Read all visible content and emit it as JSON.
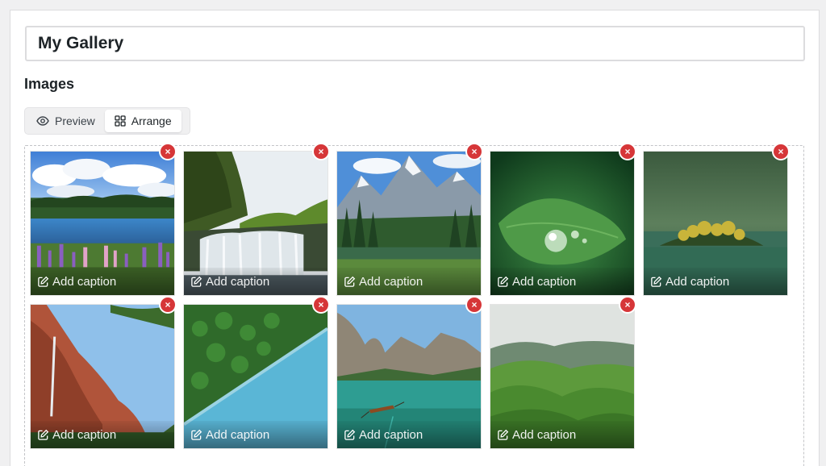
{
  "gallery": {
    "title_value": "My Gallery",
    "section_heading": "Images",
    "view_toggle": [
      {
        "label": "Preview",
        "icon": "eye-icon",
        "active": false
      },
      {
        "label": "Arrange",
        "icon": "grid-icon",
        "active": true
      }
    ],
    "accent_color": "#d63638",
    "images": [
      {
        "subject": "lake-with-lupines",
        "caption_placeholder": "Add caption",
        "remove_label": "×"
      },
      {
        "subject": "waterfall-cliff",
        "caption_placeholder": "Add caption",
        "remove_label": "×"
      },
      {
        "subject": "alpine-mountains-lake",
        "caption_placeholder": "Add caption",
        "remove_label": "×"
      },
      {
        "subject": "water-drop-on-leaf",
        "caption_placeholder": "Add caption",
        "remove_label": "×"
      },
      {
        "subject": "misty-lake-island",
        "caption_placeholder": "Add caption",
        "remove_label": "×"
      },
      {
        "subject": "red-canyon-waterfall",
        "caption_placeholder": "Add caption",
        "remove_label": "×"
      },
      {
        "subject": "aerial-forest-coast",
        "caption_placeholder": "Add caption",
        "remove_label": "×"
      },
      {
        "subject": "boat-on-mountain-lake",
        "caption_placeholder": "Add caption",
        "remove_label": "×"
      },
      {
        "subject": "green-rolling-hills",
        "caption_placeholder": "Add caption",
        "remove_label": "×"
      }
    ]
  }
}
